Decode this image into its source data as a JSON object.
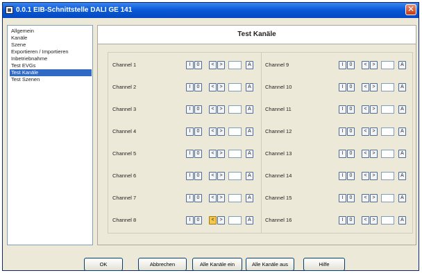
{
  "window": {
    "title": "0.0.1  EIB-Schnittstelle DALI GE 141"
  },
  "nav": {
    "items": [
      {
        "label": "Allgemein",
        "selected": false
      },
      {
        "label": "Kanäle",
        "selected": false
      },
      {
        "label": "Szene",
        "selected": false
      },
      {
        "label": "Exportieren / Importieren",
        "selected": false
      },
      {
        "label": "Inbetriebnahme",
        "selected": false
      },
      {
        "label": "Test EVGs",
        "selected": false
      },
      {
        "label": "Test Kanäle",
        "selected": true
      },
      {
        "label": "Test Szenen",
        "selected": false
      }
    ]
  },
  "panel": {
    "title": "Test Kanäle"
  },
  "channel_buttons": {
    "on": "I",
    "off": "0",
    "left": "<",
    "right": ">",
    "apply": "A"
  },
  "channels": [
    {
      "label": "Channel 1",
      "left_highlighted": false
    },
    {
      "label": "Channel 2",
      "left_highlighted": false
    },
    {
      "label": "Channel 3",
      "left_highlighted": false
    },
    {
      "label": "Channel 4",
      "left_highlighted": false
    },
    {
      "label": "Channel 5",
      "left_highlighted": false
    },
    {
      "label": "Channel 6",
      "left_highlighted": false
    },
    {
      "label": "Channel 7",
      "left_highlighted": false
    },
    {
      "label": "Channel 8",
      "left_highlighted": true
    },
    {
      "label": "Channel 9",
      "left_highlighted": false
    },
    {
      "label": "Channel 10",
      "left_highlighted": false
    },
    {
      "label": "Channel 11",
      "left_highlighted": false
    },
    {
      "label": "Channel 12",
      "left_highlighted": false
    },
    {
      "label": "Channel 13",
      "left_highlighted": false
    },
    {
      "label": "Channel 14",
      "left_highlighted": false
    },
    {
      "label": "Channel 15",
      "left_highlighted": false
    },
    {
      "label": "Channel 16",
      "left_highlighted": false
    }
  ],
  "footer": {
    "ok": "OK",
    "cancel": "Abbrechen",
    "all_on": "Alle Kanäle ein",
    "all_off": "Alle Kanäle aus",
    "help": "Hilfe"
  },
  "colors": {
    "title_bar": "#0a5ad8",
    "selection": "#316ac5",
    "highlight": "#f5c84c"
  },
  "icons": {
    "app": "app-icon",
    "close": "close-icon"
  }
}
